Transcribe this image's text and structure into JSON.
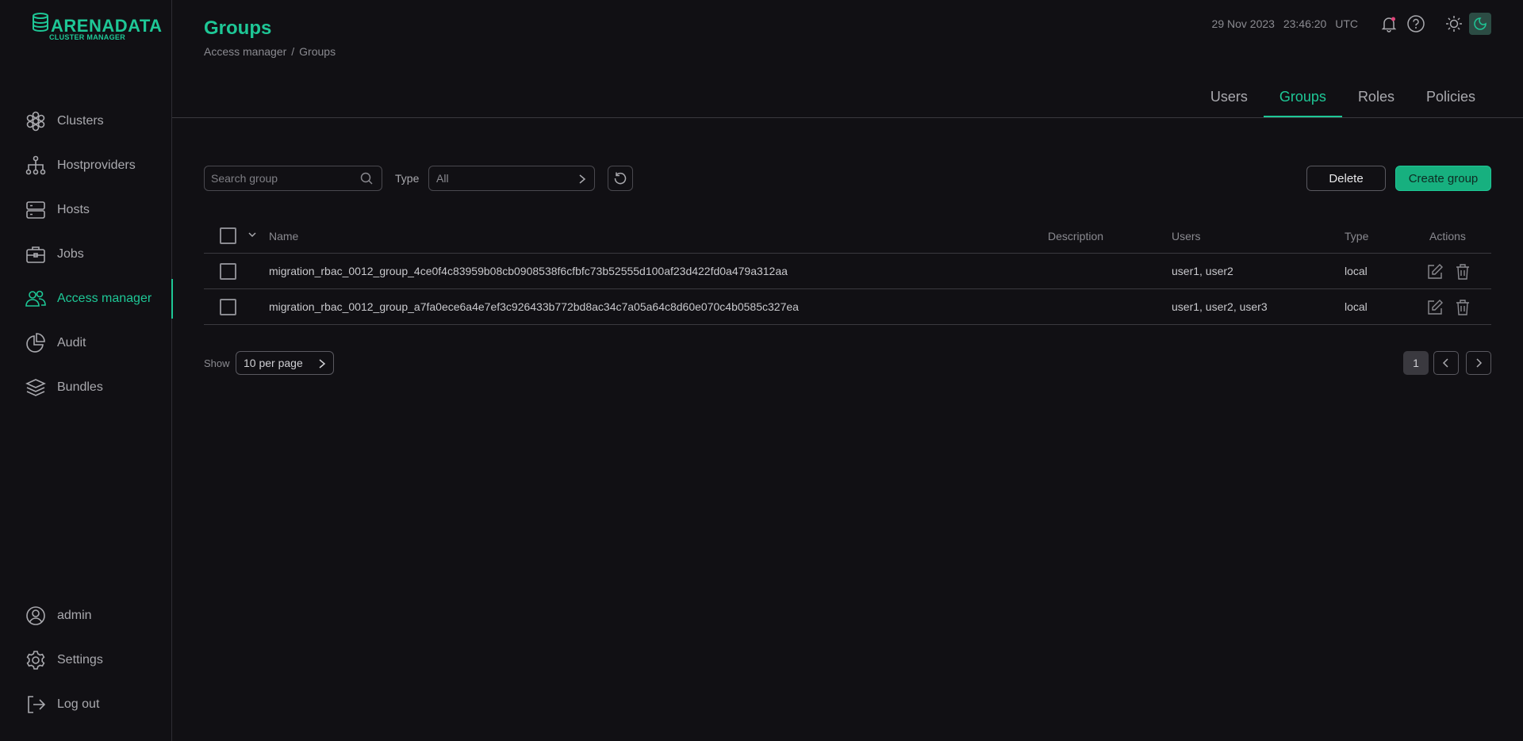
{
  "app": {
    "logo_main": "ARENADATA",
    "logo_sub": "CLUSTER MANAGER",
    "accent_color": "#1ec796"
  },
  "sidebar": {
    "items": [
      {
        "label": "Clusters",
        "icon": "clusters-icon"
      },
      {
        "label": "Hostproviders",
        "icon": "hostproviders-icon"
      },
      {
        "label": "Hosts",
        "icon": "hosts-icon"
      },
      {
        "label": "Jobs",
        "icon": "jobs-icon"
      },
      {
        "label": "Access manager",
        "icon": "access-manager-icon",
        "active": true
      },
      {
        "label": "Audit",
        "icon": "audit-icon"
      },
      {
        "label": "Bundles",
        "icon": "bundles-icon"
      }
    ],
    "bottom_items": [
      {
        "label": "admin",
        "icon": "user-icon"
      },
      {
        "label": "Settings",
        "icon": "gear-icon"
      },
      {
        "label": "Log out",
        "icon": "logout-icon"
      }
    ]
  },
  "header": {
    "title": "Groups",
    "breadcrumb": [
      "Access manager",
      "Groups"
    ],
    "breadcrumb_sep": "/",
    "date": "29 Nov 2023",
    "time": "23:46:20",
    "timezone": "UTC",
    "icons": [
      "bell-icon",
      "help-icon",
      "sun-icon",
      "theme-toggle-icon"
    ]
  },
  "tabs": [
    {
      "label": "Users"
    },
    {
      "label": "Groups",
      "active": true
    },
    {
      "label": "Roles"
    },
    {
      "label": "Policies"
    }
  ],
  "toolbar": {
    "search_placeholder": "Search group",
    "search_value": "",
    "type_label": "Type",
    "type_value": "All",
    "delete_label": "Delete",
    "create_label": "Create group"
  },
  "table": {
    "columns": [
      "Name",
      "Description",
      "Users",
      "Type",
      "Actions"
    ],
    "rows": [
      {
        "name": "migration_rbac_0012_group_4ce0f4c83959b08cb0908538f6cfbfc73b52555d100af23d422fd0a479a312aa",
        "description": "",
        "users": "user1, user2",
        "type": "local"
      },
      {
        "name": "migration_rbac_0012_group_a7fa0ece6a4e7ef3c926433b772bd8ac34c7a05a64c8d60e070c4b0585c327ea",
        "description": "",
        "users": "user1, user2, user3",
        "type": "local"
      }
    ]
  },
  "pagination": {
    "show_label": "Show",
    "per_page": "10 per page",
    "current_page": "1"
  }
}
